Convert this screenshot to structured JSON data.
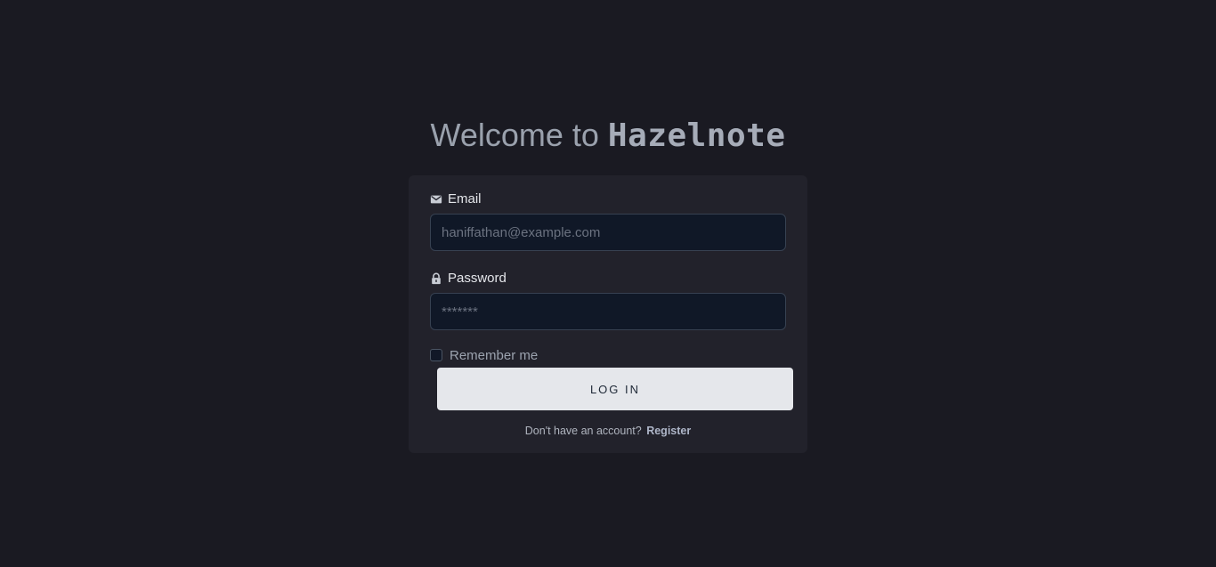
{
  "header": {
    "welcome_text": "Welcome to",
    "brand": "Hazelnote"
  },
  "form": {
    "email": {
      "icon": "mail-icon",
      "label": "Email",
      "placeholder": "haniffathan@example.com",
      "value": ""
    },
    "password": {
      "icon": "lock-icon",
      "label": "Password",
      "placeholder": "*******",
      "value": ""
    },
    "remember_label": "Remember me",
    "remember_checked": false,
    "login_label": "LOG IN"
  },
  "footer": {
    "prompt": "Don't have an account?",
    "register_label": "Register"
  },
  "colors": {
    "background": "#1a1a22",
    "card": "#22222b",
    "input_bg": "#101827",
    "button_bg": "#e5e7eb"
  }
}
